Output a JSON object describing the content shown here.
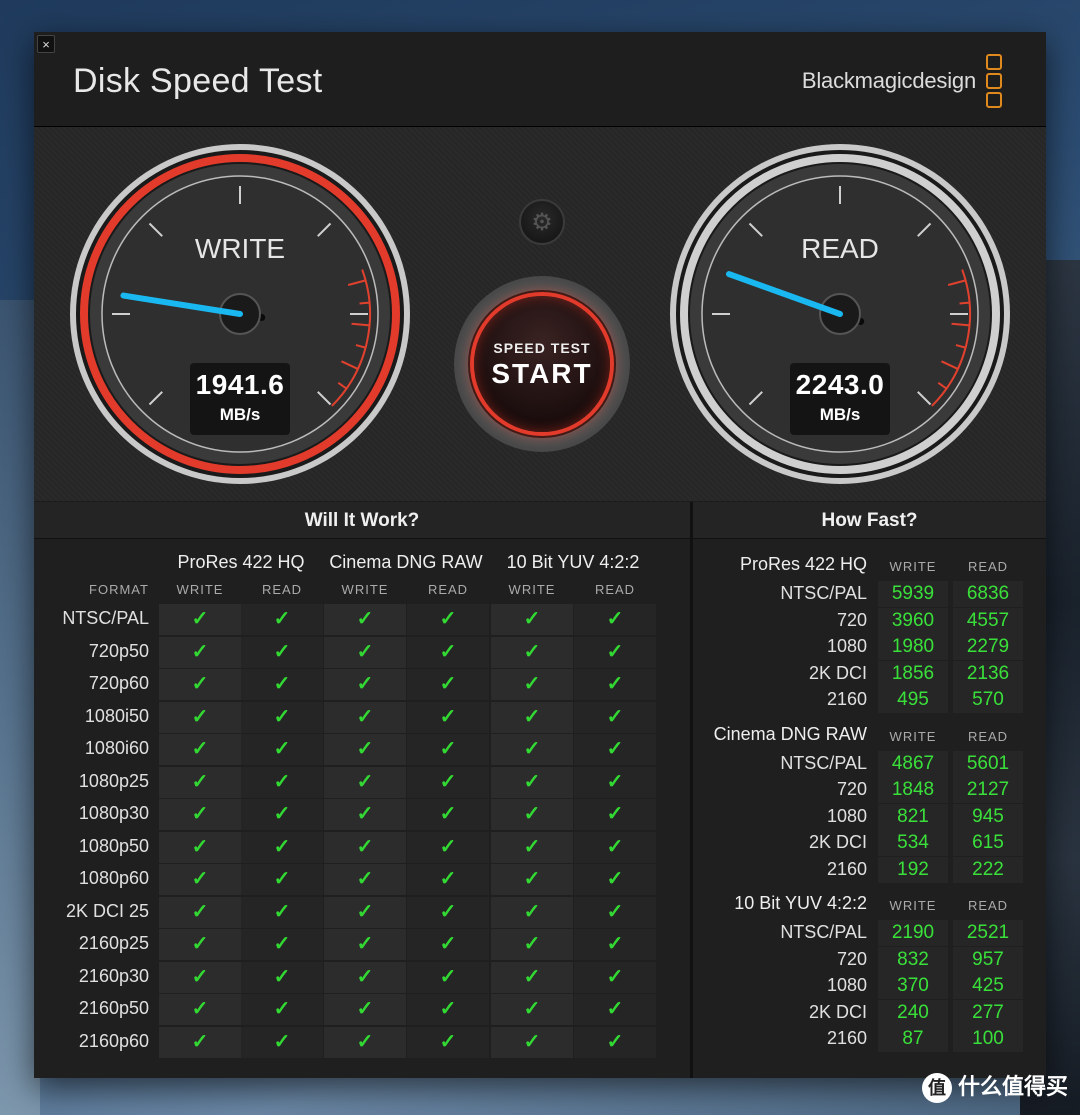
{
  "window": {
    "title": "Disk Speed Test",
    "brand": "Blackmagicdesign",
    "close_label": "×"
  },
  "gauges": {
    "write": {
      "label": "WRITE",
      "value": "1941.6",
      "unit": "MB/s",
      "needle_fraction": 0.2
    },
    "read": {
      "label": "READ",
      "value": "2243.0",
      "unit": "MB/s",
      "needle_fraction": 0.24
    }
  },
  "start_button": {
    "top": "SPEED TEST",
    "main": "START"
  },
  "settings_icon": "gear-icon",
  "will_it_work": {
    "title": "Will It Work?",
    "format_header": "FORMAT",
    "groups": [
      "ProRes 422 HQ",
      "Cinema DNG RAW",
      "10 Bit YUV 4:2:2"
    ],
    "col_headers": [
      "WRITE",
      "READ",
      "WRITE",
      "READ",
      "WRITE",
      "READ"
    ],
    "rows": [
      "NTSC/PAL",
      "720p50",
      "720p60",
      "1080i50",
      "1080i60",
      "1080p25",
      "1080p30",
      "1080p50",
      "1080p60",
      "2K DCI 25",
      "2160p25",
      "2160p30",
      "2160p50",
      "2160p60"
    ],
    "check": "✓"
  },
  "how_fast": {
    "title": "How Fast?",
    "col_write": "WRITE",
    "col_read": "READ",
    "groups": [
      {
        "name": "ProRes 422 HQ",
        "rows": [
          {
            "label": "NTSC/PAL",
            "write": "5939",
            "read": "6836"
          },
          {
            "label": "720",
            "write": "3960",
            "read": "4557"
          },
          {
            "label": "1080",
            "write": "1980",
            "read": "2279"
          },
          {
            "label": "2K DCI",
            "write": "1856",
            "read": "2136"
          },
          {
            "label": "2160",
            "write": "495",
            "read": "570"
          }
        ]
      },
      {
        "name": "Cinema DNG RAW",
        "rows": [
          {
            "label": "NTSC/PAL",
            "write": "4867",
            "read": "5601"
          },
          {
            "label": "720",
            "write": "1848",
            "read": "2127"
          },
          {
            "label": "1080",
            "write": "821",
            "read": "945"
          },
          {
            "label": "2K DCI",
            "write": "534",
            "read": "615"
          },
          {
            "label": "2160",
            "write": "192",
            "read": "222"
          }
        ]
      },
      {
        "name": "10 Bit YUV 4:2:2",
        "rows": [
          {
            "label": "NTSC/PAL",
            "write": "2190",
            "read": "2521"
          },
          {
            "label": "720",
            "write": "832",
            "read": "957"
          },
          {
            "label": "1080",
            "write": "370",
            "read": "425"
          },
          {
            "label": "2K DCI",
            "write": "240",
            "read": "277"
          },
          {
            "label": "2160",
            "write": "87",
            "read": "100"
          }
        ]
      }
    ]
  },
  "watermark": {
    "icon": "值",
    "text": "什么值得买"
  }
}
